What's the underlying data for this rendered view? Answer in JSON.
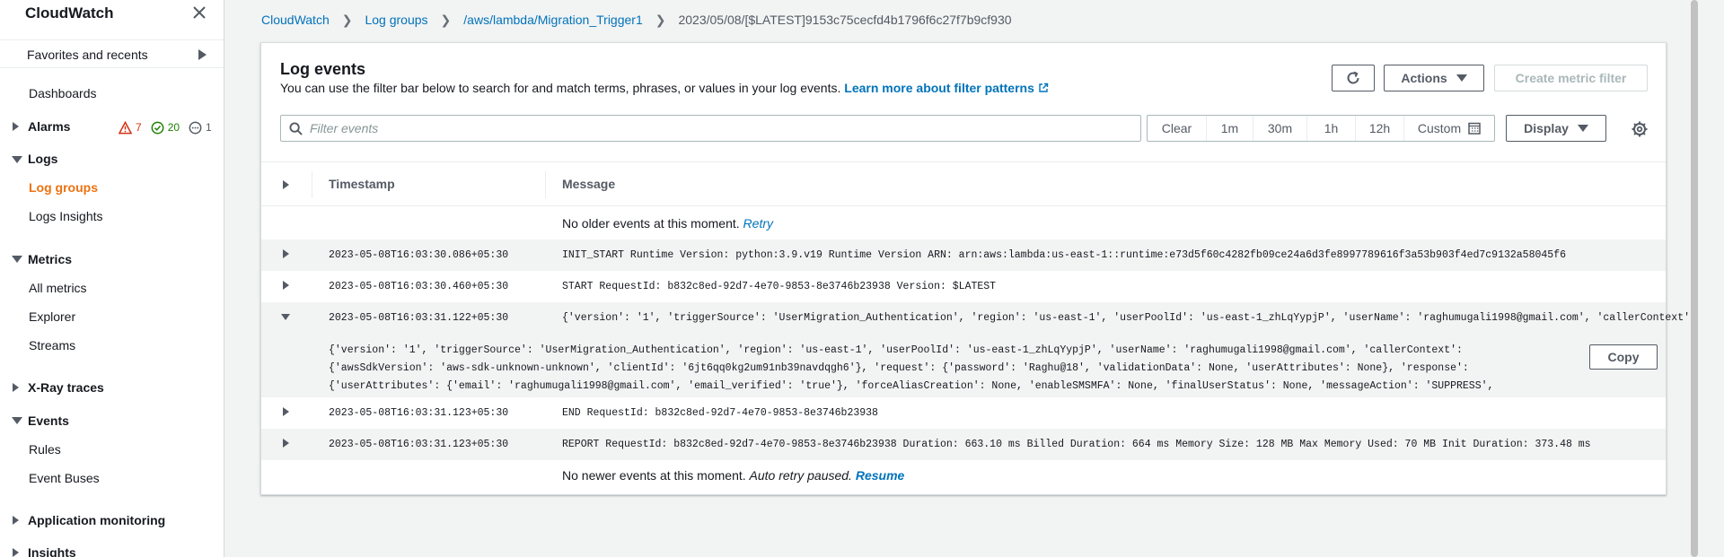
{
  "sidebar": {
    "title": "CloudWatch",
    "favorites": "Favorites and recents",
    "dashboards": "Dashboards",
    "alarms": "Alarms",
    "alarm_counts": {
      "in_alarm": "7",
      "ok": "20",
      "insufficient": "1"
    },
    "logs": "Logs",
    "log_groups": "Log groups",
    "logs_insights": "Logs Insights",
    "metrics": "Metrics",
    "all_metrics": "All metrics",
    "explorer": "Explorer",
    "streams": "Streams",
    "xray": "X-Ray traces",
    "events": "Events",
    "rules": "Rules",
    "event_buses": "Event Buses",
    "app_monitoring": "Application monitoring",
    "insights": "Insights"
  },
  "breadcrumb": {
    "cloudwatch": "CloudWatch",
    "log_groups": "Log groups",
    "log_group": "/aws/lambda/Migration_Trigger1",
    "stream": "2023/05/08/[$LATEST]9153c75cecfd4b1796f6c27f7b9cf930"
  },
  "panel": {
    "title": "Log events",
    "description": "You can use the filter bar below to search for and match terms, phrases, or values in your log events.",
    "learn_more": "Learn more about filter patterns",
    "actions_label": "Actions",
    "create_metric_filter": "Create metric filter",
    "filter_placeholder": "Filter events",
    "time_options": [
      "Clear",
      "1m",
      "30m",
      "1h",
      "12h"
    ],
    "custom_label": "Custom",
    "display_label": "Display"
  },
  "table": {
    "col_timestamp": "Timestamp",
    "col_message": "Message",
    "no_older": "No older events at this moment.",
    "retry": "Retry",
    "no_newer": "No newer events at this moment.",
    "auto_retry": "Auto retry paused.",
    "resume": "Resume",
    "copy_label": "Copy",
    "rows": [
      {
        "timestamp": "2023-05-08T16:03:30.086+05:30",
        "message": "INIT_START Runtime Version: python:3.9.v19 Runtime Version ARN: arn:aws:lambda:us-east-1::runtime:e73d5f60c4282fb09ce24a6d3fe8997789616f3a53b903f4ed7c9132a58045f6"
      },
      {
        "timestamp": "2023-05-08T16:03:30.460+05:30",
        "message": "START RequestId: b832c8ed-92d7-4e70-9853-8e3746b23938 Version: $LATEST"
      },
      {
        "timestamp": "2023-05-08T16:03:31.122+05:30",
        "message": "{'version': '1', 'triggerSource': 'UserMigration_Authentication', 'region': 'us-east-1', 'userPoolId': 'us-east-1_zhLqYypjP', 'userName': 'raghumugali1998@gmail.com', 'callerContext'…"
      },
      {
        "timestamp": "2023-05-08T16:03:31.123+05:30",
        "message": "END RequestId: b832c8ed-92d7-4e70-9853-8e3746b23938"
      },
      {
        "timestamp": "2023-05-08T16:03:31.123+05:30",
        "message": "REPORT RequestId: b832c8ed-92d7-4e70-9853-8e3746b23938 Duration: 663.10 ms Billed Duration: 664 ms Memory Size: 128 MB Max Memory Used: 70 MB Init Duration: 373.48 ms"
      }
    ],
    "expanded_text": "{'version': '1', 'triggerSource': 'UserMigration_Authentication', 'region': 'us-east-1', 'userPoolId': 'us-east-1_zhLqYypjP', 'userName': 'raghumugali1998@gmail.com', 'callerContext': {'awsSdkVersion': 'aws-sdk-unknown-unknown', 'clientId': '6jt6qq0kg2um91nb39navdqgh6'}, 'request': {'password': 'Raghu@18', 'validationData': None, 'userAttributes': None}, 'response': {'userAttributes': {'email': 'raghumugali1998@gmail.com', 'email_verified': 'true'}, 'forceAliasCreation': None, 'enableSMSMFA': None, 'finalUserStatus': None, 'messageAction': 'SUPPRESS', 'desiredDeliveryMediums': None}}"
  },
  "colors": {
    "link": "#0073bb",
    "active_nav": "#ec7211",
    "alarm": "#d13212",
    "ok": "#1d8102"
  }
}
